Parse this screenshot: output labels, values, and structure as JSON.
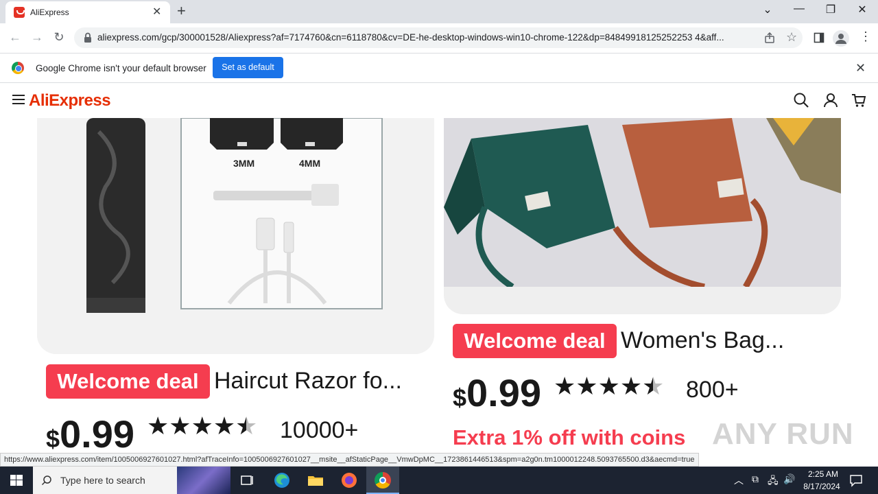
{
  "browser": {
    "tab_title": "AliExpress",
    "url": "aliexpress.com/gcp/300001528/Aliexpress?af=7174760&cn=6118780&cv=DE-he-desktop-windows-win10-chrome-122&dp=84849918125252253 4&aff...",
    "infobar_text": "Google Chrome isn't your default browser",
    "set_default_label": "Set as default"
  },
  "site": {
    "logo": "AliExpress"
  },
  "products": [
    {
      "badge": "Welcome deal",
      "title": "Haircut Razor fo...",
      "currency": "$",
      "price": "0.99",
      "rating": 4.5,
      "sold": "10000+",
      "image_labels": [
        "3MM",
        "4MM"
      ]
    },
    {
      "badge": "Welcome deal",
      "title": "Women's Bag...",
      "currency": "$",
      "price": "0.99",
      "rating": 4.5,
      "sold": "800+",
      "promo": "Extra 1% off with coins"
    }
  ],
  "status_url": "https://www.aliexpress.com/item/1005006927601027.html?afTraceInfo=1005006927601027__msite__afStaticPage__VmwDpMC__1723861446513&spm=a2g0n.tm1000012248.5093765500.d3&aecmd=true",
  "taskbar": {
    "search_placeholder": "Type here to search",
    "time": "2:25 AM",
    "date": "8/17/2024"
  },
  "watermark": "ANY RUN",
  "colors": {
    "accent_red": "#f53d4f",
    "brand": "#e62e04",
    "chrome_blue": "#1a73e8"
  }
}
